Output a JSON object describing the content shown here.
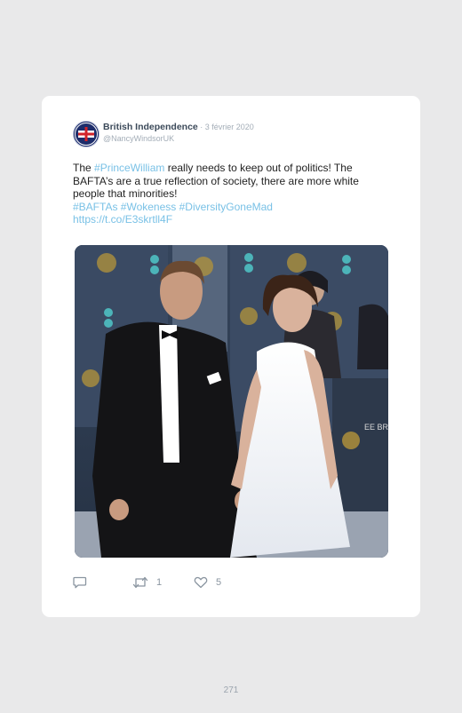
{
  "tweet": {
    "display_name": "British Independence",
    "separator": " · ",
    "date": "3 février 2020",
    "handle": "@NancyWindsorUK",
    "text": {
      "t1": "The ",
      "h1": "#PrinceWilliam",
      "t2": " really needs to keep out of politics! The BAFTA’s are a true reflection of society, there are more white people that minorities!",
      "tags": "#BAFTAs #Wokeness #DiversityGoneMad",
      "link": "https://t.co/E3skrtll4F"
    },
    "actions": {
      "reply_icon": "reply-icon",
      "retweet_icon": "retweet-icon",
      "retweet_count": "1",
      "like_icon": "heart-icon",
      "like_count": "5"
    },
    "colors": {
      "accent": "#79c1e6",
      "name": "#3c4a5a",
      "muted": "#a3adb7"
    }
  },
  "photo": {
    "backdrop_text": "EE BRIT FILM"
  },
  "page_number": "271"
}
